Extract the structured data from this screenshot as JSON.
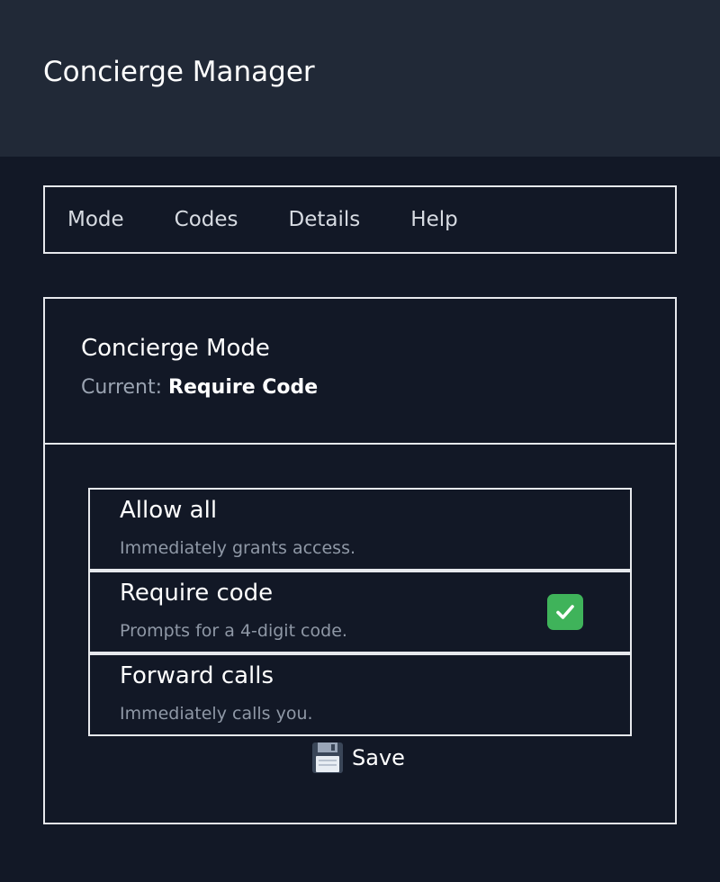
{
  "header": {
    "title": "Concierge Manager"
  },
  "nav": {
    "items": [
      {
        "label": "Mode"
      },
      {
        "label": "Codes"
      },
      {
        "label": "Details"
      },
      {
        "label": "Help"
      }
    ]
  },
  "panel": {
    "title": "Concierge Mode",
    "current_prefix": "Current:",
    "current_value": "Require Code"
  },
  "options": [
    {
      "label": "Allow all",
      "description": "Immediately grants access.",
      "selected": false
    },
    {
      "label": "Require code",
      "description": "Prompts for a 4-digit code.",
      "selected": true
    },
    {
      "label": "Forward calls",
      "description": "Immediately calls you.",
      "selected": false
    }
  ],
  "save": {
    "label": "Save",
    "icon": "floppy-disk-icon"
  },
  "colors": {
    "background": "#121826",
    "header_background": "#212937",
    "border": "#e6e8ec",
    "check_green": "#3fb35a"
  }
}
